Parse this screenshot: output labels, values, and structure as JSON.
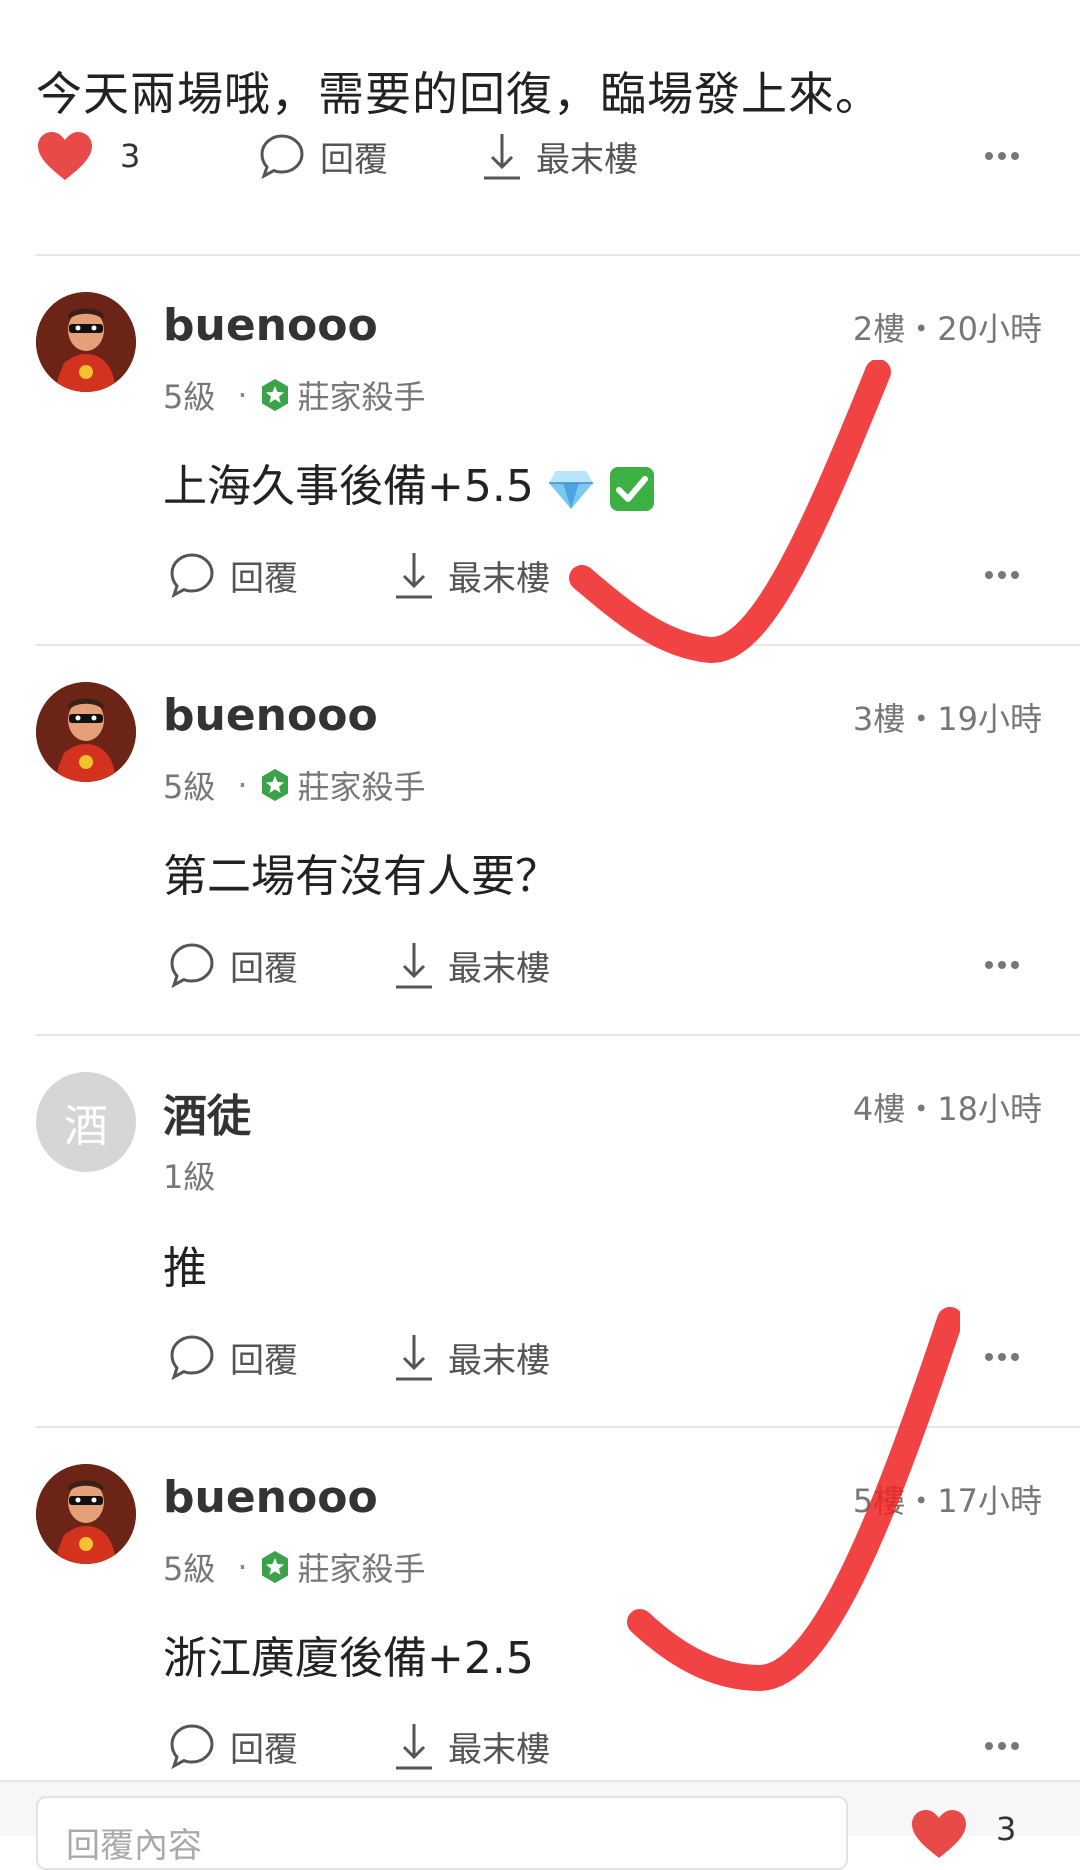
{
  "post": {
    "text": "今天兩場哦，需要的回復，臨場發上來。",
    "like_count": "3",
    "reply_label": "回覆",
    "last_floor_label": "最末樓"
  },
  "comments": [
    {
      "username": "buenooo",
      "floor_time": "2樓・20小時",
      "level": "5級",
      "badge": "莊家殺手",
      "content": "上海久事後備+5.5",
      "reply_label": "回覆",
      "last_floor_label": "最末樓"
    },
    {
      "username": "buenooo",
      "floor_time": "3樓・19小時",
      "level": "5級",
      "badge": "莊家殺手",
      "content": "第二場有沒有人要？",
      "reply_label": "回覆",
      "last_floor_label": "最末樓"
    },
    {
      "username": "酒徒",
      "avatar_letter": "酒",
      "floor_time": "4樓・18小時",
      "level": "1級",
      "content": "推",
      "reply_label": "回覆",
      "last_floor_label": "最末樓"
    },
    {
      "username": "buenooo",
      "floor_time": "5樓・17小時",
      "level": "5級",
      "badge": "莊家殺手",
      "content": "浙江廣廈後備+2.5",
      "reply_label": "回覆",
      "last_floor_label": "最末樓"
    }
  ],
  "bottom": {
    "reply_placeholder": "回覆內容",
    "like_count": "3"
  },
  "colors": {
    "heart": "#e84a4a",
    "badge_green": "#3aa34a",
    "check_red": "#ee2222"
  }
}
